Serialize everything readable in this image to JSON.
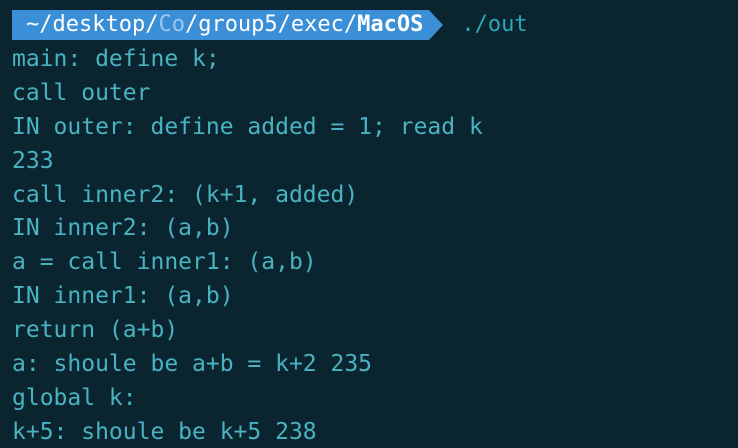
{
  "prompt": {
    "path_prefix": "~/desktop/",
    "path_dim": "Co",
    "path_middle": "/group5/exec/",
    "path_current": "MacOS",
    "command": "./out"
  },
  "output_lines": [
    "main: define k;",
    "call outer",
    "IN outer: define added = 1; read k",
    "233",
    "call inner2: (k+1, added)",
    "IN inner2: (a,b)",
    "a = call inner1: (a,b)",
    "IN inner1: (a,b)",
    "return (a+b)",
    "a: shoule be a+b = k+2 235",
    "global k:",
    "k+5: shoule be k+5 238"
  ],
  "colors": {
    "background": "#0b2530",
    "prompt_bg": "#3b8fd6",
    "text": "#49b3c1"
  }
}
